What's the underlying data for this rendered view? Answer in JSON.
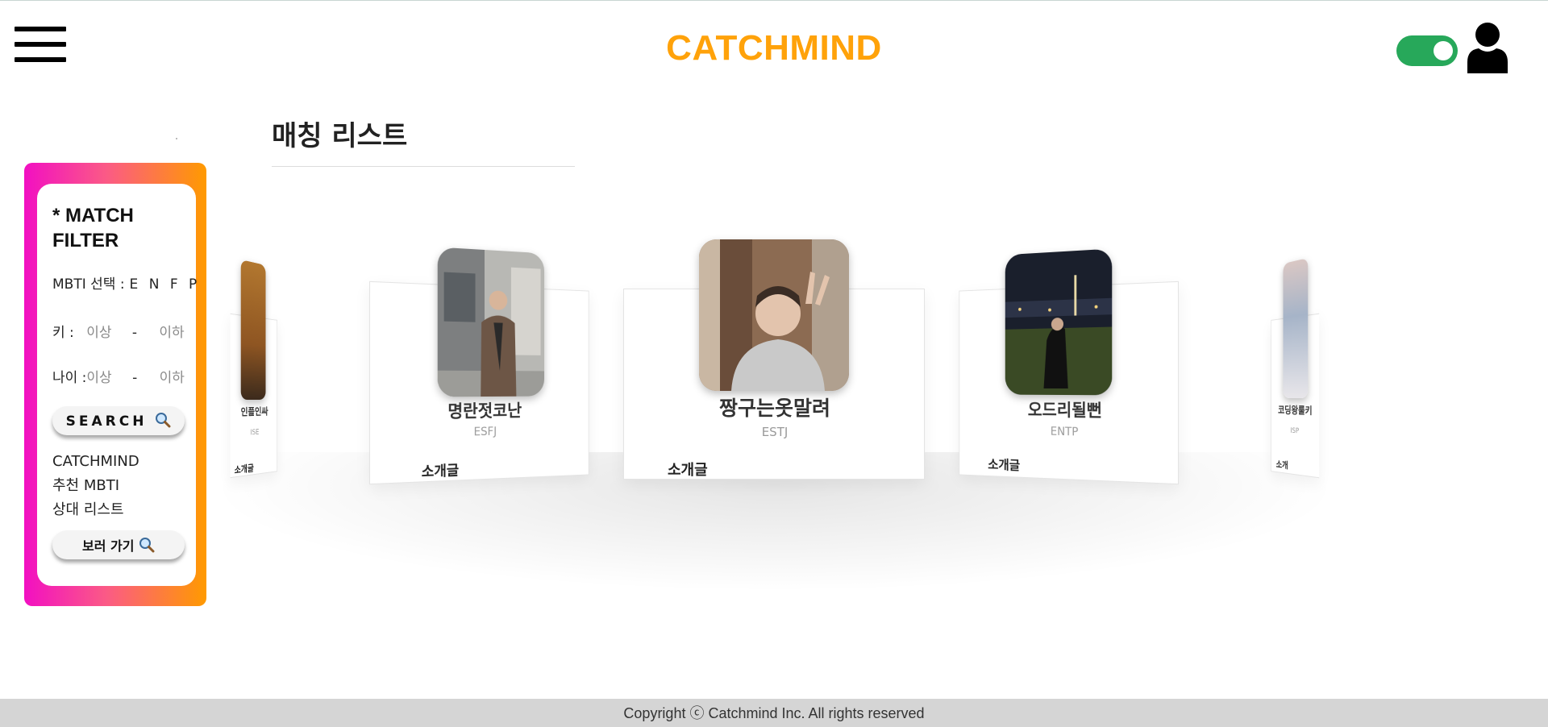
{
  "header": {
    "logo": "CATCHMIND",
    "theme_toggle_on": true
  },
  "page_title": "매칭 리스트",
  "filter": {
    "title": "* MATCH FILTER",
    "mbti_label": "MBTI 선택 :",
    "mbti_value": "E N F P",
    "height_label": "키 :",
    "age_label": "나이 :",
    "min_placeholder": "이상",
    "max_placeholder": "이하",
    "range_separator": "-",
    "search_button": "SEARCH",
    "recommend_line1": "CATCHMIND",
    "recommend_line2": "추천 MBTI",
    "recommend_line3": "상대 리스트",
    "view_button": "보러 가기"
  },
  "cards": [
    {
      "name": "인플인싸",
      "mbti": "ISE",
      "intro": "소개글"
    },
    {
      "name": "명란젓코난",
      "mbti": "ESFJ",
      "intro": "소개글"
    },
    {
      "name": "짱구는옷말려",
      "mbti": "ESTJ",
      "intro": "소개글"
    },
    {
      "name": "오드리될뻔",
      "mbti": "ENTP",
      "intro": "소개글"
    },
    {
      "name": "코딩왕룰키",
      "mbti": "ISP",
      "intro": "소개"
    }
  ],
  "footer": "Copyright ⓒ Catchmind Inc. All rights reserved",
  "colors": {
    "logo": "#ffa20a",
    "toggle": "#27a85a",
    "filter_gradient_start": "#f20fc2",
    "filter_gradient_end": "#ff9a00",
    "footer_bg": "#d5d5d5"
  },
  "icons": {
    "menu": "hamburger-menu-icon",
    "user": "user-profile-icon",
    "search": "magnifier-icon"
  }
}
